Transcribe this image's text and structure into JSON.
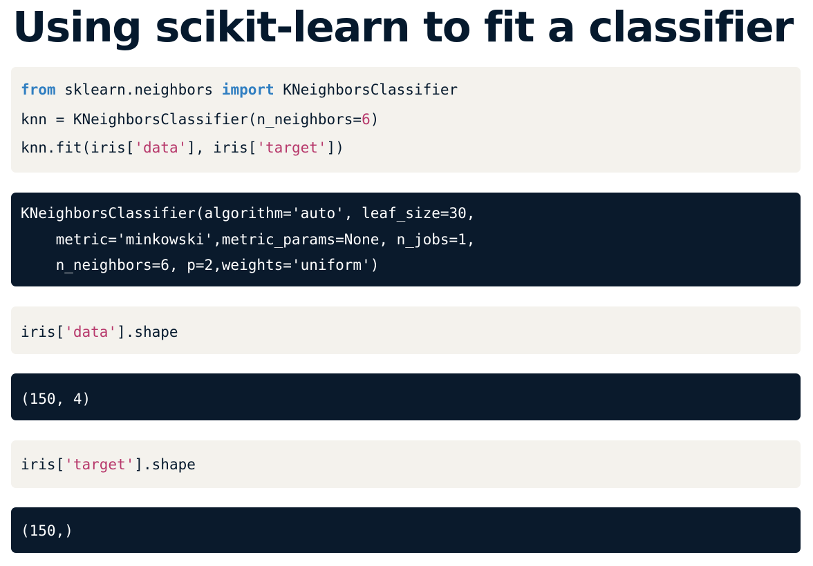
{
  "title": "Using scikit-learn to fit a classifier",
  "cells": {
    "import_cell": {
      "line1": {
        "kw1": "from",
        "module": " sklearn.neighbors ",
        "kw2": "import",
        "name": " KNeighborsClassifier"
      },
      "line2": {
        "prefix": "knn = KNeighborsClassifier(n_neighbors=",
        "num": "6",
        "suffix": ")"
      },
      "line3": {
        "prefix": "knn.fit(iris[",
        "str1": "'data'",
        "mid": "], iris[",
        "str2": "'target'",
        "suffix": "])"
      }
    },
    "fit_output": {
      "line1": "KNeighborsClassifier(algorithm='auto', leaf_size=30,",
      "line2": "    metric='minkowski',metric_params=None, n_jobs=1,",
      "line3": "    n_neighbors=6, p=2,weights='uniform')"
    },
    "data_shape_cell": {
      "prefix": "iris[",
      "str": "'data'",
      "suffix": "].shape"
    },
    "data_shape_output": "(150, 4)",
    "target_shape_cell": {
      "prefix": "iris[",
      "str": "'target'",
      "suffix": "].shape"
    },
    "target_shape_output": "(150,)"
  },
  "colors": {
    "title": "#05192d",
    "code_background": "#f4f2ed",
    "output_background": "#0a1a2c",
    "keyword": "#2f7ec1",
    "string": "#b7386b"
  }
}
